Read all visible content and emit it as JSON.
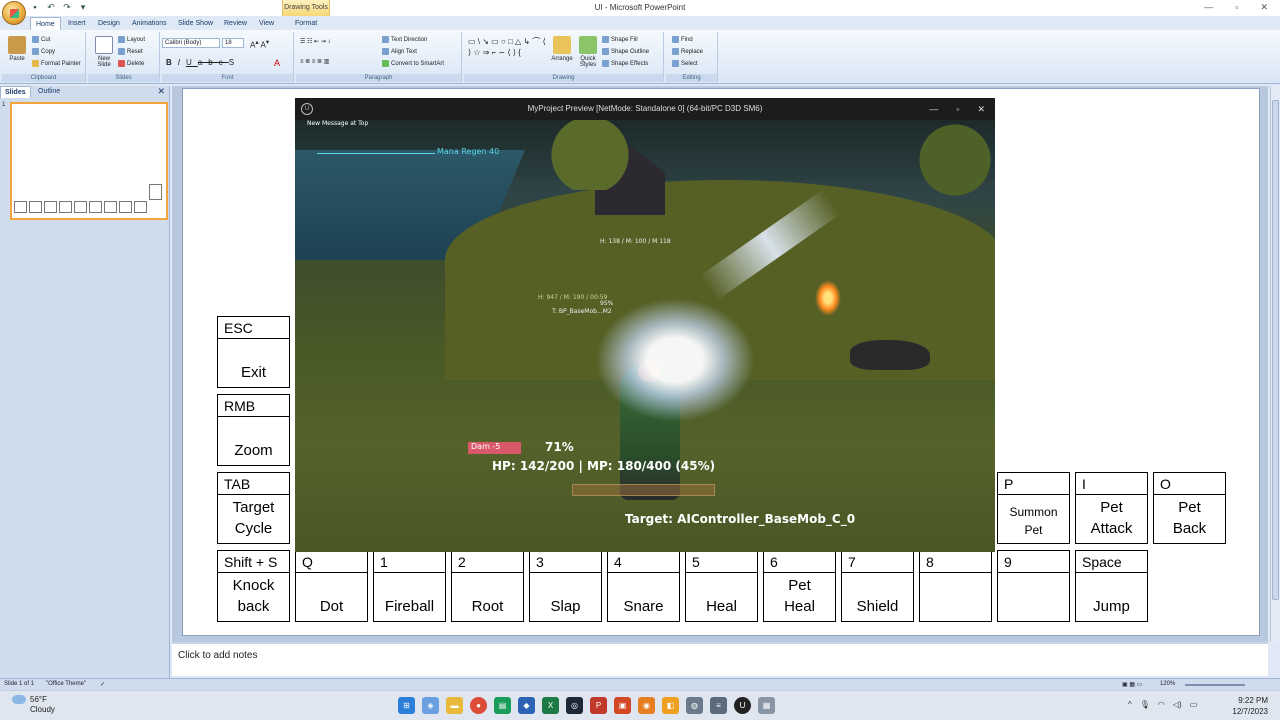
{
  "window": {
    "title": "UI - Microsoft PowerPoint",
    "contextual_tab": "Drawing Tools"
  },
  "ribbon_tabs": [
    "Home",
    "Insert",
    "Design",
    "Animations",
    "Slide Show",
    "Review",
    "View",
    "Format"
  ],
  "ribbon": {
    "clipboard": {
      "paste": "Paste",
      "cut": "Cut",
      "copy": "Copy",
      "format_painter": "Format Painter",
      "label": "Clipboard"
    },
    "slides": {
      "new_slide": "New Slide",
      "layout": "Layout",
      "reset": "Reset",
      "delete": "Delete",
      "label": "Slides"
    },
    "font": {
      "name": "Calibri (Body)",
      "size": "18",
      "label": "Font"
    },
    "paragraph": {
      "text_direction": "Text Direction",
      "align_text": "Align Text",
      "convert_smartart": "Convert to SmartArt",
      "label": "Paragraph"
    },
    "drawing": {
      "arrange": "Arrange",
      "quick_styles": "Quick Styles",
      "shape_fill": "Shape Fill",
      "shape_outline": "Shape Outline",
      "shape_effects": "Shape Effects",
      "label": "Drawing"
    },
    "editing": {
      "find": "Find",
      "replace": "Replace",
      "select": "Select",
      "label": "Editing"
    }
  },
  "pane": {
    "tabs": [
      "Slides",
      "Outline"
    ],
    "slide_number": "1"
  },
  "notes_placeholder": "Click to add notes",
  "keys": [
    {
      "key": "ESC",
      "action": "Exit"
    },
    {
      "key": "RMB",
      "action": "Zoom"
    },
    {
      "key": "TAB",
      "action": "Target\nCycle"
    },
    {
      "key": "Shift + S",
      "action": "Knock\nback"
    },
    {
      "key": "Q",
      "action": "Dot"
    },
    {
      "key": "1",
      "action": "Fireball"
    },
    {
      "key": "2",
      "action": "Root"
    },
    {
      "key": "3",
      "action": "Slap"
    },
    {
      "key": "4",
      "action": "Snare"
    },
    {
      "key": "5",
      "action": "Heal"
    },
    {
      "key": "6",
      "action": "Pet\nHeal"
    },
    {
      "key": "7",
      "action": "Shield"
    },
    {
      "key": "8",
      "action": ""
    },
    {
      "key": "9",
      "action": ""
    },
    {
      "key": "Space",
      "action": "Jump"
    },
    {
      "key": "P",
      "action": "Summon\nPet"
    },
    {
      "key": "I",
      "action": "Pet\nAttack"
    },
    {
      "key": "O",
      "action": "Pet\nBack"
    }
  ],
  "game": {
    "title": "MyProject Preview [NetMode: Standalone 0]  (64-bit/PC D3D SM6)",
    "message_top": "New Message at Top",
    "mana_regen": "Mana Regen 40",
    "damage": "Dam -5",
    "percent": "71%",
    "hp_mp": "HP: 142/200 | MP: 180/400 (45%)",
    "target": "Target: AIController_BaseMob_C_0",
    "enemy_hp": "H: 947 / M: 190 / 00:59",
    "enemy_name": "T: BP_BaseMob...M2",
    "enemy_pct": "95%",
    "enemy2": "H: 138 / M: 100 / M 118"
  },
  "status": {
    "slide": "Slide 1 of 1",
    "theme": "\"Office Theme\"",
    "zoom": "120%"
  },
  "taskbar": {
    "temp": "56°F",
    "weather": "Cloudy",
    "time": "9:22 PM",
    "date": "12/7/2023"
  }
}
